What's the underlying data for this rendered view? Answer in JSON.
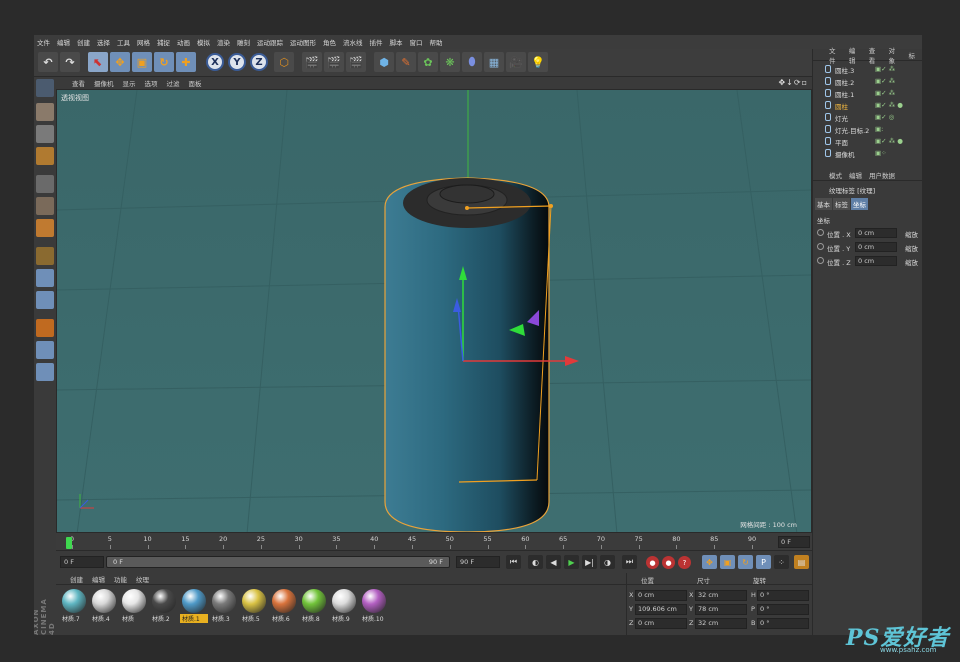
{
  "menubar": [
    "文件",
    "编辑",
    "创建",
    "选择",
    "工具",
    "网格",
    "捕捉",
    "动画",
    "模拟",
    "渲染",
    "雕刻",
    "运动跟踪",
    "运动图形",
    "角色",
    "流水线",
    "插件",
    "脚本",
    "窗口",
    "帮助"
  ],
  "viewport": {
    "menu": [
      "查看",
      "摄像机",
      "显示",
      "选项",
      "过滤",
      "面板"
    ],
    "nav_icons": "✥↓⟳▫",
    "label": "透视视图",
    "grid_label": "网格间距 : 100 cm",
    "bg_color": "#3b6a6c"
  },
  "objects": [
    {
      "name": "圆柱.3",
      "tags": "▣✓ ⁂",
      "selected": false
    },
    {
      "name": "圆柱.2",
      "tags": "▣✓ ⁂",
      "selected": false
    },
    {
      "name": "圆柱.1",
      "tags": "▣✓ ⁂",
      "selected": false
    },
    {
      "name": "圆柱",
      "tags": "▣✓ ⁂ ●",
      "selected": true
    },
    {
      "name": "灯光",
      "tags": "▣✓ ◎",
      "selected": false
    },
    {
      "name": "灯光.目标.2",
      "tags": "▣:",
      "selected": false
    },
    {
      "name": "平面",
      "tags": "▣✓ ⁂ ●",
      "selected": false
    },
    {
      "name": "摄像机",
      "tags": "▣⁘",
      "selected": false
    }
  ],
  "object_menu": [
    "文件",
    "编辑",
    "查看",
    "对象",
    "标"
  ],
  "attributes": {
    "menu": [
      "模式",
      "编辑",
      "用户数据"
    ],
    "title": "纹理标签 [纹理]",
    "tabs": [
      "基本",
      "标签",
      "坐标"
    ],
    "active_tab": "坐标",
    "section": "坐标",
    "rows": [
      {
        "label": "位置 . X",
        "value": "0 cm",
        "suffix": "缩放"
      },
      {
        "label": "位置 . Y",
        "value": "0 cm",
        "suffix": "缩放"
      },
      {
        "label": "位置 . Z",
        "value": "0 cm",
        "suffix": "缩放"
      }
    ]
  },
  "timeline": {
    "ticks": [
      "0",
      "5",
      "10",
      "15",
      "20",
      "25",
      "30",
      "35",
      "40",
      "45",
      "50",
      "55",
      "60",
      "65",
      "70",
      "75",
      "80",
      "85",
      "90"
    ],
    "frame_end": "0 F",
    "current_frame": "0 F",
    "slider_start": "0 F",
    "slider_end": "90 F",
    "max_frame": "90 F"
  },
  "material_menu": [
    "创建",
    "编辑",
    "功能",
    "纹理"
  ],
  "materials": [
    {
      "name": "材质.7",
      "color": "#5fb6c2",
      "active": false
    },
    {
      "name": "材质.4",
      "color": "#d8d8d8",
      "active": false
    },
    {
      "name": "材质",
      "color": "#e6e6e6",
      "active": false
    },
    {
      "name": "材质.2",
      "color": "#4a4a4a",
      "active": false
    },
    {
      "name": "材质.1",
      "color": "#4f9ac8",
      "active": true
    },
    {
      "name": "材质.3",
      "color": "#7a7a7a",
      "active": false
    },
    {
      "name": "材质.5",
      "color": "#d9c244",
      "active": false
    },
    {
      "name": "材质.6",
      "color": "#d9733c",
      "active": false
    },
    {
      "name": "材质.8",
      "color": "#72c43a",
      "active": false
    },
    {
      "name": "材质.9",
      "color": "#dcdcdc",
      "active": false
    },
    {
      "name": "材质.10",
      "color": "#b35fc2",
      "active": false
    }
  ],
  "coords": {
    "headers": [
      "位置",
      "尺寸",
      "旋转"
    ],
    "rows": [
      {
        "a": "X",
        "pos": "0 cm",
        "b": "X",
        "size": "32 cm",
        "c": "H",
        "rot": "0 °"
      },
      {
        "a": "Y",
        "pos": "109.606 cm",
        "b": "Y",
        "size": "78 cm",
        "c": "P",
        "rot": "0 °"
      },
      {
        "a": "Z",
        "pos": "0 cm",
        "b": "Z",
        "size": "32 cm",
        "c": "B",
        "rot": "0 °"
      }
    ]
  },
  "brand": "AXON CINEMA 4D",
  "watermark": "PS爱好者",
  "watermark_url": "www.psahz.com",
  "accent": "#f0a020"
}
